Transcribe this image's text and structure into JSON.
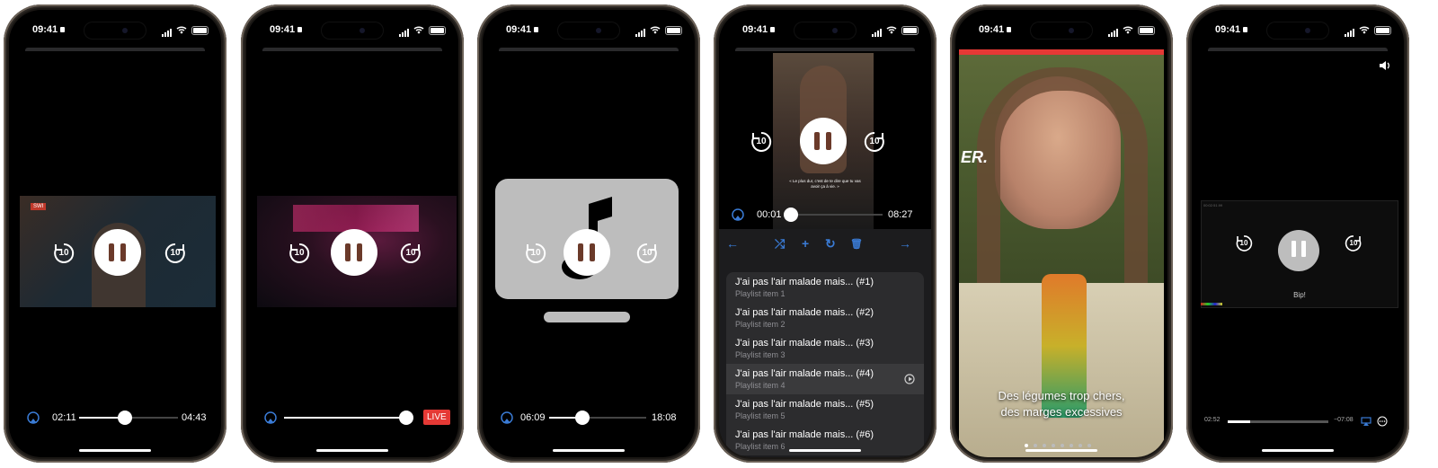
{
  "status": {
    "time": "09:41"
  },
  "phone1": {
    "time_elapsed": "02:11",
    "time_total": "04:43",
    "progress": 0.46,
    "thumb_badge": "SWI",
    "skip_back": "10",
    "skip_fwd": "10"
  },
  "phone2": {
    "live_label": "LIVE",
    "progress": 1.0,
    "skip_back": "10",
    "skip_fwd": "10"
  },
  "phone3": {
    "time_elapsed": "06:09",
    "time_total": "18:08",
    "progress": 0.34,
    "skip_back": "10",
    "skip_fwd": "10"
  },
  "phone4": {
    "time_elapsed": "00:01",
    "time_total": "08:27",
    "progress": 0.0,
    "skip_back": "10",
    "skip_fwd": "10",
    "subtitle": "« Le plus dur, c'est de te dire que tu vas avoir ça à vie. »",
    "toolbar": {
      "back": "←",
      "shuffle": "⤮",
      "add": "+",
      "reload": "↻",
      "delete": "🗑",
      "forward": "→"
    },
    "playlist": [
      {
        "title": "J'ai pas l'air malade mais... (#1)",
        "subtitle": "Playlist item 1"
      },
      {
        "title": "J'ai pas l'air malade mais... (#2)",
        "subtitle": "Playlist item 2"
      },
      {
        "title": "J'ai pas l'air malade mais... (#3)",
        "subtitle": "Playlist item 3"
      },
      {
        "title": "J'ai pas l'air malade mais... (#4)",
        "subtitle": "Playlist item 4"
      },
      {
        "title": "J'ai pas l'air malade mais... (#5)",
        "subtitle": "Playlist item 5"
      },
      {
        "title": "J'ai pas l'air malade mais... (#6)",
        "subtitle": "Playlist item 6"
      }
    ]
  },
  "phone5": {
    "caption_line1": "Des légumes trop chers,",
    "caption_line2": "des marges excessives",
    "logo_text": "ER.",
    "page_count": 8
  },
  "phone6": {
    "time_elapsed": "02:52",
    "time_remaining": "−07:08",
    "progress": 0.22,
    "bip": "Bip!",
    "skip_back": "10",
    "skip_fwd": "10",
    "timecode": "00:02:51.99"
  },
  "colors": {
    "accent": "#3a7bd5",
    "live": "#e53935",
    "brand_red": "#e53935"
  }
}
